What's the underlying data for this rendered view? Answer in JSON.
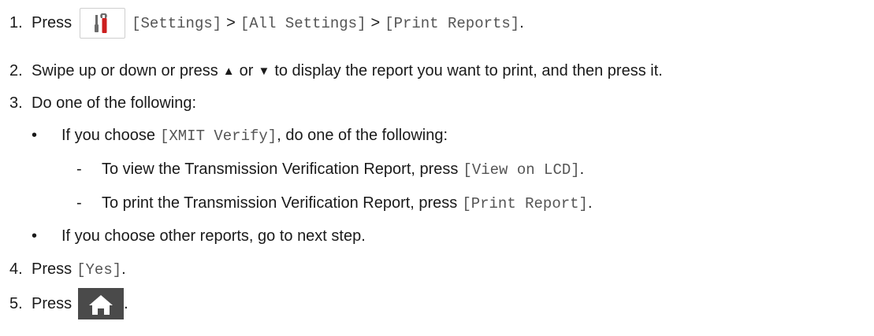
{
  "steps": {
    "s1": {
      "num": "1.",
      "prefix": "Press",
      "icon": "settings-tools-icon",
      "path": "[Settings]",
      "sep1": ">",
      "path2": "[All Settings]",
      "sep2": ">",
      "path3": "[Print Reports]",
      "end": "."
    },
    "s2": {
      "num": "2.",
      "text_a": "Swipe up or down or press",
      "up": "▲",
      "text_b": "or",
      "down": "▼",
      "text_c": "to display the report you want to print, and then press it."
    },
    "s3": {
      "num": "3.",
      "text": "Do one of the following:"
    },
    "b1": {
      "bullet": "•",
      "text_a": "If you choose",
      "code": "[XMIT Verify]",
      "text_b": ", do one of the following:"
    },
    "d1": {
      "dash": "-",
      "text": "To view the Transmission Verification Report, press",
      "code": "[View on LCD]",
      "end": "."
    },
    "d2": {
      "dash": "-",
      "text": "To print the Transmission Verification Report, press",
      "code": "[Print Report]",
      "end": "."
    },
    "b2": {
      "bullet": "•",
      "text": "If you choose other reports, go to next step."
    },
    "s4": {
      "num": "4.",
      "prefix": "Press",
      "code": "[Yes]",
      "end": "."
    },
    "s5": {
      "num": "5.",
      "prefix": "Press",
      "icon": "home-icon",
      "end": "."
    }
  },
  "colors": {
    "text": "#1a1a1a",
    "code": "#555555",
    "tool_red": "#cc1f1f",
    "tool_gray": "#6b6b6b",
    "home": "#4a4a4a"
  }
}
